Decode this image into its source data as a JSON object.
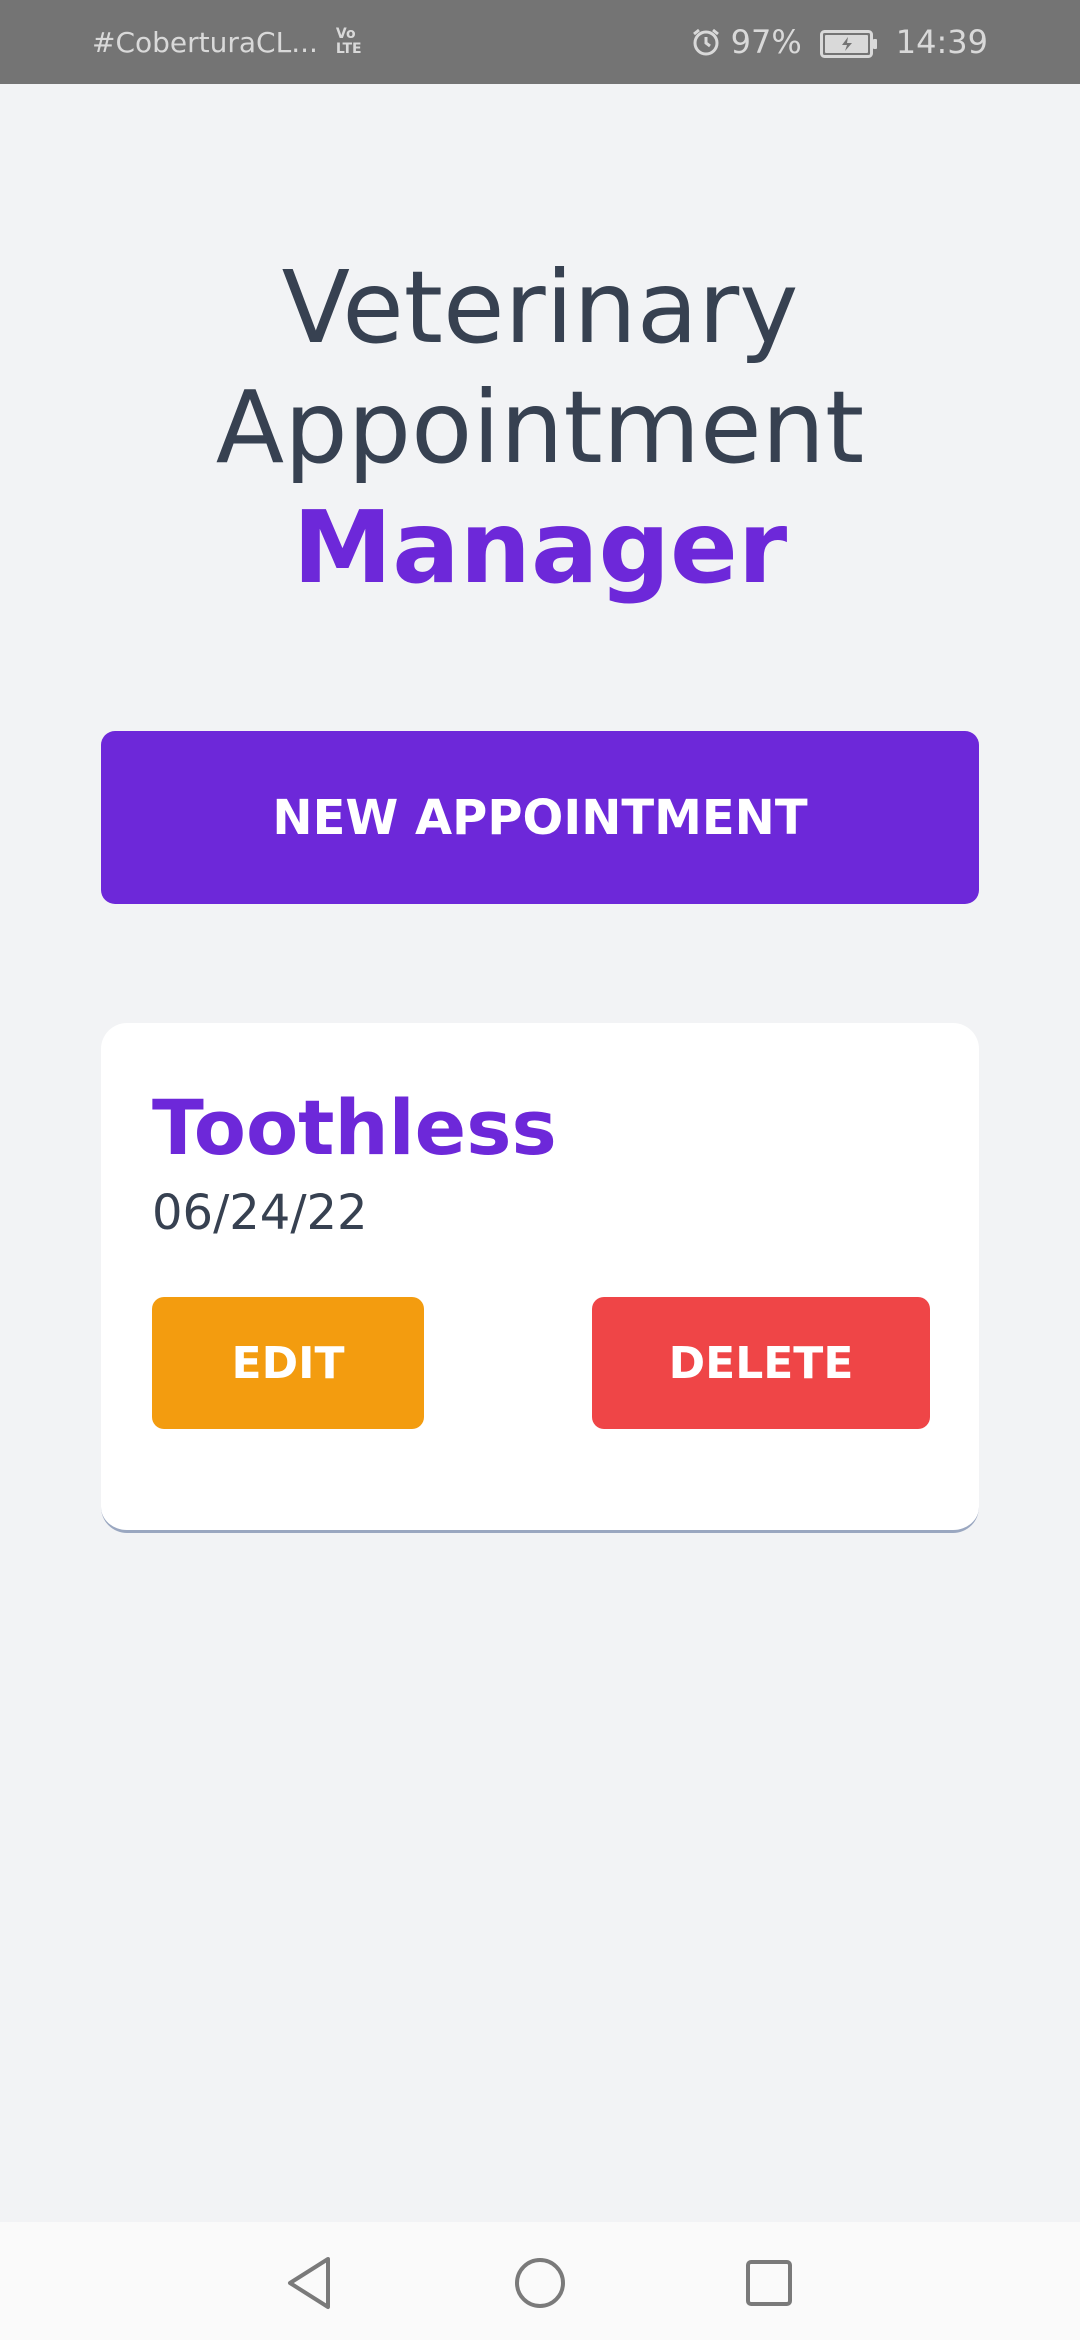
{
  "status_bar": {
    "carrier": "#CoberturaCL...",
    "network_top": "Vo",
    "network_bottom": "LTE",
    "battery_percent": "97%",
    "time": "14:39",
    "icons": [
      "alarm-icon",
      "battery-charging-icon"
    ]
  },
  "header": {
    "title_line1": "Veterinary",
    "title_line2": "Appointment",
    "title_accent": "Manager"
  },
  "actions": {
    "new_appointment_label": "NEW APPOINTMENT"
  },
  "appointments": [
    {
      "pet_name": "Toothless",
      "date": "06/24/22",
      "edit_label": "EDIT",
      "delete_label": "DELETE"
    }
  ],
  "navigation": {
    "icons": [
      "back-icon",
      "home-icon",
      "recents-icon"
    ]
  },
  "colors": {
    "accent": "#6d28d9",
    "edit": "#f39c0f",
    "delete": "#ef4547",
    "text": "#374151",
    "background": "#f2f3f5"
  }
}
